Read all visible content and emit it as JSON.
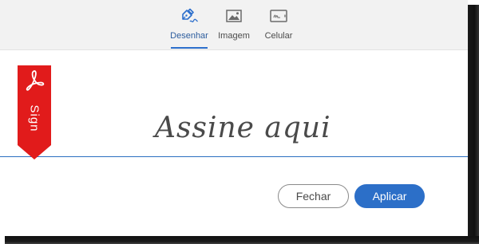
{
  "tabs": [
    {
      "label": "Desenhar",
      "icon": "pen-draw-icon",
      "active": true
    },
    {
      "label": "Imagem",
      "icon": "image-icon",
      "active": false
    },
    {
      "label": "Celular",
      "icon": "mobile-signature-icon",
      "active": false
    }
  ],
  "signature": {
    "placeholder": "Assine aqui",
    "ribbon_label": "Sign",
    "ribbon_icon": "adobe-acrobat-icon",
    "ribbon_color": "#e11b1b"
  },
  "buttons": {
    "close_label": "Fechar",
    "apply_label": "Aplicar"
  },
  "colors": {
    "accent": "#2c6fc8",
    "toolbar_bg": "#f2f2f2"
  }
}
